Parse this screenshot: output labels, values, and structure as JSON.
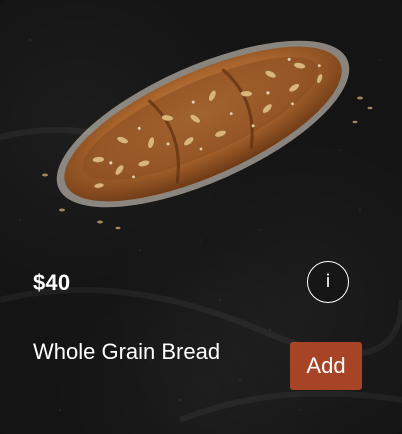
{
  "product": {
    "price": "$40",
    "name": "Whole Grain Bread",
    "image_icon": "whole-grain-bread-image"
  },
  "actions": {
    "info_icon": "i",
    "add_label": "Add"
  },
  "colors": {
    "background": "#141414",
    "text": "#ffffff",
    "add_button": "#a84426"
  }
}
